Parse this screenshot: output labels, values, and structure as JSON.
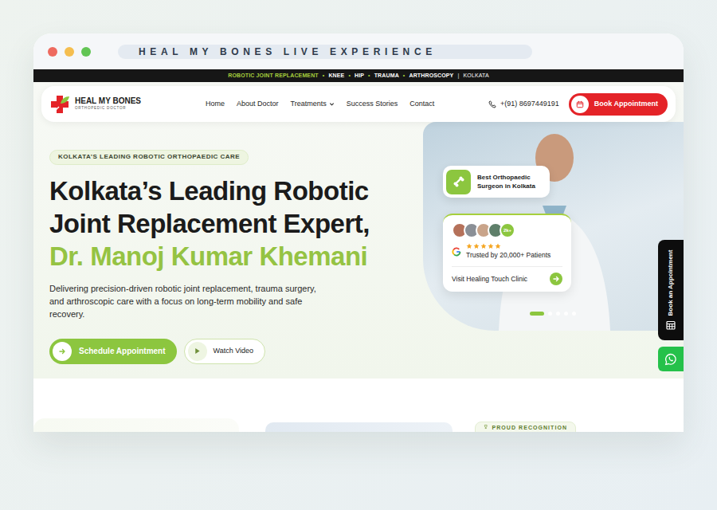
{
  "window": {
    "title": "HEAL MY BONES LIVE EXPERIENCE"
  },
  "ticker": {
    "items": [
      {
        "label": "ROBOTIC JOINT REPLACEMENT",
        "highlight": true
      },
      {
        "label": "KNEE",
        "highlight": false
      },
      {
        "label": "HIP",
        "highlight": false
      },
      {
        "label": "TRAUMA",
        "highlight": false
      },
      {
        "label": "ARTHROSCOPY",
        "highlight": false
      }
    ],
    "separator": "•",
    "divider": "|",
    "location": "KOLKATA"
  },
  "brand": {
    "name": "HEAL MY BONES",
    "tagline": "ORTHOPEDIC DOCTOR"
  },
  "nav": {
    "items": [
      {
        "label": "Home",
        "has_menu": false
      },
      {
        "label": "About Doctor",
        "has_menu": false
      },
      {
        "label": "Treatments",
        "has_menu": true
      },
      {
        "label": "Success Stories",
        "has_menu": false
      },
      {
        "label": "Contact",
        "has_menu": false
      }
    ]
  },
  "phone": "+(91) 8697449191",
  "book_button": "Book Appointment",
  "hero": {
    "badge": "KOLKATA’S LEADING ROBOTIC ORTHOPAEDIC CARE",
    "title_lines": [
      "Kolkata’s Leading Robotic",
      "Joint Replacement Expert,"
    ],
    "doctor_name": "Dr. Manoj Kumar Khemani",
    "description": "Delivering precision-driven robotic joint replacement, trauma surgery, and arthroscopic care with a focus on long-term mobility and safe recovery.",
    "primary_button": "Schedule Appointment",
    "secondary_button": "Watch Video"
  },
  "highlight_card": {
    "lines": [
      "Best Orthopaedic",
      "Surgeon in Kolkata"
    ]
  },
  "trust_card": {
    "avatars": [
      {
        "color": "#b5715a"
      },
      {
        "color": "#8a8f96"
      },
      {
        "color": "#c9a48a"
      },
      {
        "color": "#5f7f6a"
      }
    ],
    "count": "2k+",
    "stars": 5,
    "label": "Trusted by 20,000+ Patients",
    "link": "Visit Healing Touch Clinic"
  },
  "carousel": {
    "slides": [
      {
        "selected": true
      },
      {
        "selected": false
      },
      {
        "selected": false
      },
      {
        "selected": false
      },
      {
        "selected": false
      }
    ]
  },
  "side_tab": {
    "label": "Book an Appointment"
  },
  "recognition": {
    "badge": "PROUD RECOGNITION"
  }
}
